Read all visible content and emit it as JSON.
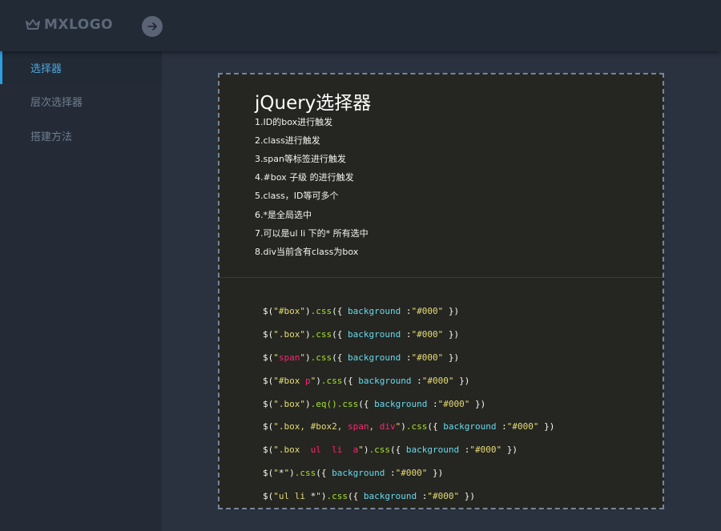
{
  "header": {
    "logo_text": "MXLOGO",
    "logo_icon": "crown-icon",
    "toggle_icon": "arrow-right-icon"
  },
  "sidebar": {
    "items": [
      {
        "label": "选择器",
        "active": true
      },
      {
        "label": "层次选择器",
        "active": false
      },
      {
        "label": "搭建方法",
        "active": false
      }
    ]
  },
  "main": {
    "title": "jQuery选择器",
    "points": [
      "1.ID的box进行触发",
      "2.class进行触发",
      "3.span等标签进行触发",
      "4.#box 子级 的进行触发",
      "5.class，ID等可多个",
      "6.*是全局选中",
      "7.可以是ul li 下的* 所有选中",
      "8.div当前含有class为box"
    ],
    "code": {
      "prefix": "$(",
      "open_quote": "\"",
      "css_call": ".css({ ",
      "eq_call": ".eq()",
      "prop": "background",
      "sep": " :",
      "value": "\"#000\"",
      "close": " })",
      "lines": [
        [
          [
            "str",
            "#box"
          ]
        ],
        [
          [
            "str",
            ".box"
          ]
        ],
        [
          [
            "tag",
            "span"
          ]
        ],
        [
          [
            "str",
            "#box "
          ],
          [
            "tag",
            "p"
          ]
        ],
        [
          [
            "str",
            ".box"
          ]
        ],
        [
          [
            "str",
            ".box, #box2, "
          ],
          [
            "tag",
            "span"
          ],
          [
            "str",
            ", "
          ],
          [
            "tag",
            "div"
          ]
        ],
        [
          [
            "str",
            ".box  "
          ],
          [
            "tag",
            "ul  li  a"
          ]
        ],
        [
          [
            "plain",
            "*"
          ]
        ],
        [
          [
            "str",
            "ul li "
          ],
          [
            "plain",
            "*"
          ]
        ]
      ],
      "eq_on_line": 4
    }
  },
  "colors": {
    "accent": "#4ea6dc",
    "panel_bg": "#252621",
    "code_string": "#e6db74",
    "code_tag": "#f92672",
    "code_function": "#a6e22e",
    "code_property": "#66d9ef"
  }
}
